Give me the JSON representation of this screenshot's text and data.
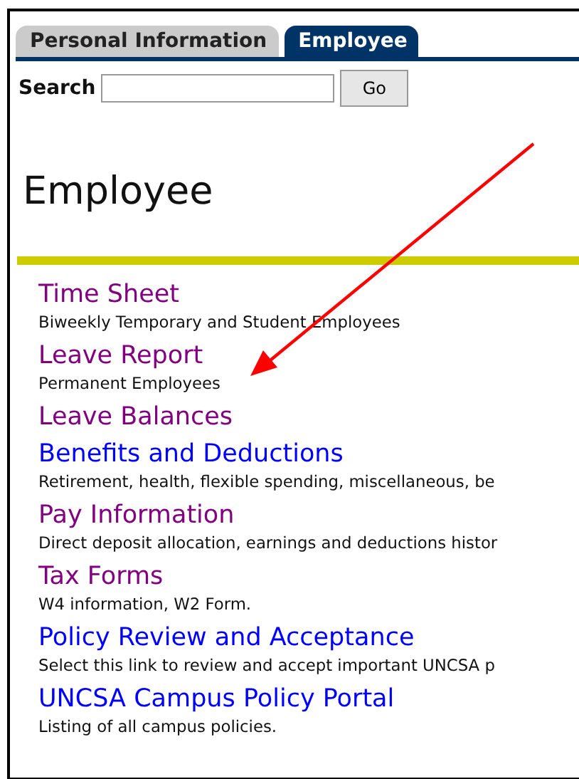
{
  "tabs": [
    {
      "label": "Personal Information",
      "selected": false
    },
    {
      "label": "Employee",
      "selected": true
    }
  ],
  "search": {
    "label": "Search",
    "button": "Go"
  },
  "heading": "Employee",
  "links": [
    {
      "title": "Time Sheet",
      "visited": true,
      "description": "Biweekly Temporary and Student Employees"
    },
    {
      "title": "Leave Report",
      "visited": true,
      "description": "Permanent Employees"
    },
    {
      "title": "Leave Balances",
      "visited": true
    },
    {
      "title": "Benefits and Deductions",
      "visited": false,
      "description": "Retirement, health, flexible spending, miscellaneous, be"
    },
    {
      "title": "Pay Information",
      "visited": true,
      "description": "Direct deposit allocation, earnings and deductions histor"
    },
    {
      "title": "Tax Forms",
      "visited": true,
      "description": "W4 information, W2 Form."
    },
    {
      "title": "Policy Review and Acceptance",
      "visited": false,
      "description": "Select this link to review and accept important UNCSA p"
    },
    {
      "title": "UNCSA Campus Policy Portal",
      "visited": false,
      "description": "Listing of all campus policies."
    }
  ]
}
